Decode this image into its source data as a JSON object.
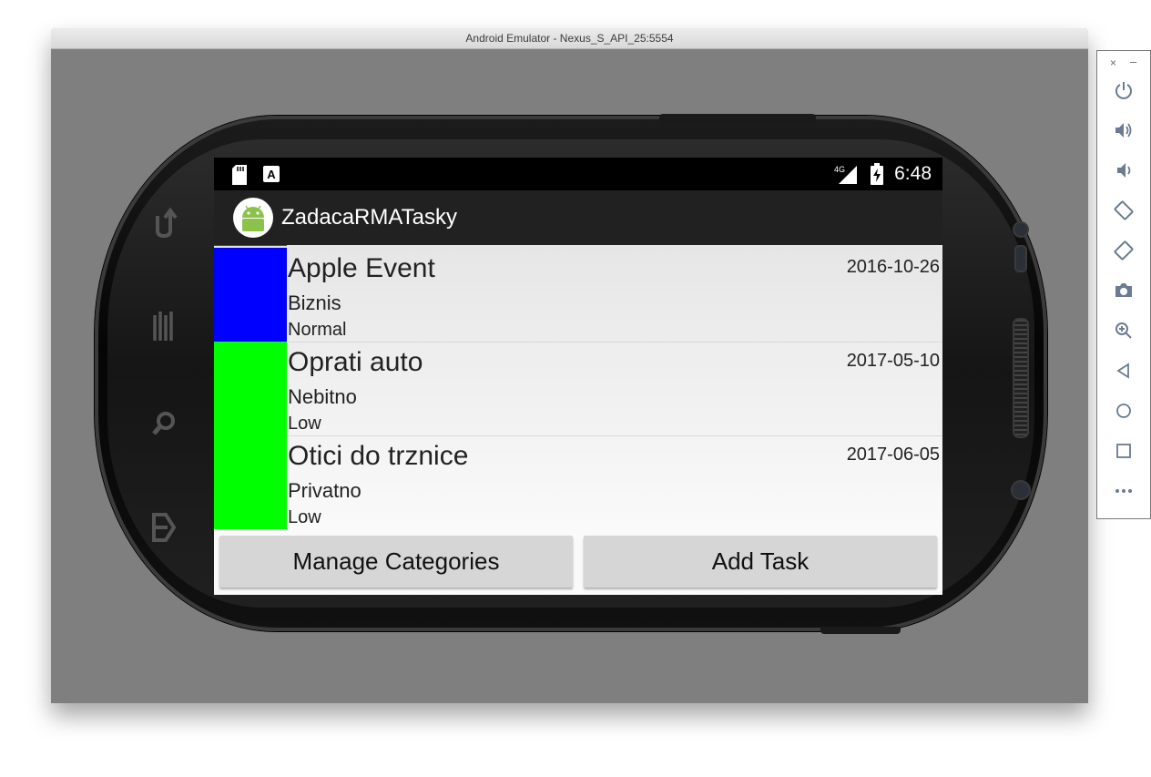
{
  "window": {
    "title": "Android Emulator - Nexus_S_API_25:5554"
  },
  "statusbar": {
    "time": "6:48",
    "network": "4G"
  },
  "app": {
    "title": "ZadacaRMATasky"
  },
  "tasks": [
    {
      "title": "Apple Event",
      "category": "Biznis",
      "priority": "Normal",
      "date": "2016-10-26",
      "color": "#0000ff"
    },
    {
      "title": "Oprati auto",
      "category": "Nebitno",
      "priority": "Low",
      "date": "2017-05-10",
      "color": "#00ff00"
    },
    {
      "title": "Otici do trznice",
      "category": "Privatno",
      "priority": "Low",
      "date": "2017-06-05",
      "color": "#00ff00"
    }
  ],
  "buttons": {
    "manage_categories": "Manage Categories",
    "add_task": "Add Task"
  },
  "toolbar": {
    "close": "×",
    "minimize": "–",
    "items": [
      "power-icon",
      "volume-up-icon",
      "volume-down-icon",
      "rotate-left-icon",
      "rotate-right-icon",
      "camera-icon",
      "zoom-icon",
      "back-icon",
      "home-icon",
      "overview-icon",
      "more-icon"
    ]
  }
}
